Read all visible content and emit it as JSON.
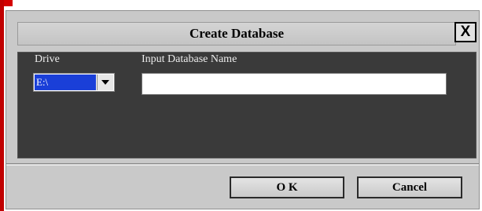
{
  "dialog": {
    "title": "Create Database",
    "close_label": "X"
  },
  "form": {
    "drive_label": "Drive",
    "drive_value": "E:\\",
    "name_label": "Input Database Name",
    "name_value": ""
  },
  "buttons": {
    "ok": "O K",
    "cancel": "Cancel"
  },
  "colors": {
    "panel": "#3a3a3a",
    "selection": "#1a3fd8",
    "dialog_bg": "#c9c9c9"
  }
}
